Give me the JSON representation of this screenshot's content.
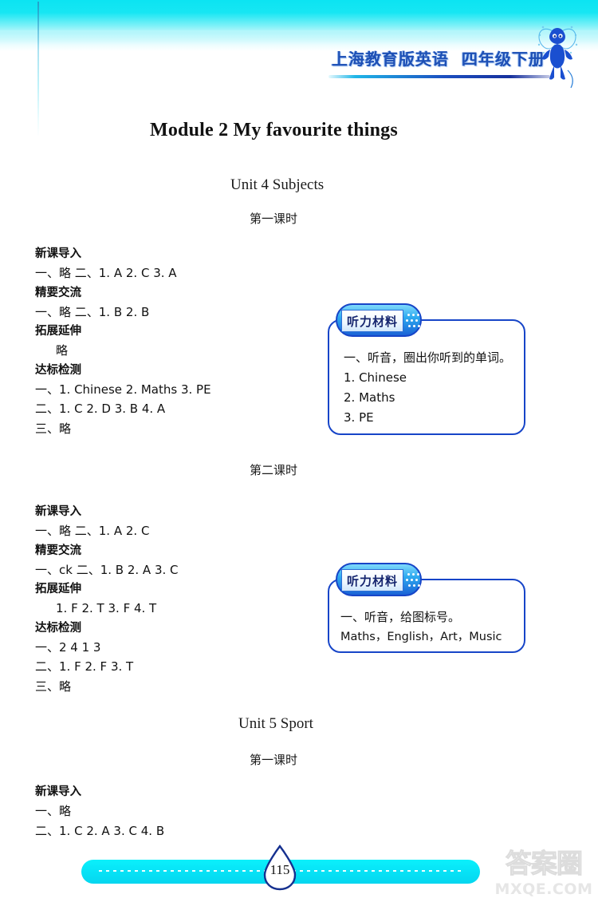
{
  "header": {
    "book_title": "上海教育版英语",
    "grade": "四年级下册",
    "mascot": "fairy-mascot"
  },
  "module": {
    "title": "Module 2 My favourite things"
  },
  "units": [
    {
      "title": "Unit 4 Subjects",
      "lessons": [
        {
          "label": "第一课时"
        },
        {
          "label": "第二课时"
        }
      ]
    },
    {
      "title": "Unit 5 Sport",
      "lessons": [
        {
          "label": "第一课时"
        }
      ]
    }
  ],
  "answers": {
    "u4_l1": [
      {
        "type": "head",
        "text": "新课导入"
      },
      {
        "type": "line",
        "text": "一、略   二、1. A  2. C  3. A"
      },
      {
        "type": "head",
        "text": "精要交流"
      },
      {
        "type": "line",
        "text": "一、略   二、1. B  2. B"
      },
      {
        "type": "head",
        "text": "拓展延伸"
      },
      {
        "type": "indent",
        "text": "略"
      },
      {
        "type": "head",
        "text": "达标检测"
      },
      {
        "type": "line",
        "text": "一、1. Chinese  2. Maths  3. PE"
      },
      {
        "type": "line",
        "text": "二、1. C  2. D  3. B  4. A"
      },
      {
        "type": "line",
        "text": "三、略"
      }
    ],
    "u4_l2": [
      {
        "type": "head",
        "text": "新课导入"
      },
      {
        "type": "line",
        "text": "一、略   二、1. A  2. C"
      },
      {
        "type": "head",
        "text": "精要交流"
      },
      {
        "type": "line",
        "text": "一、ck  二、1. B  2. A  3. C"
      },
      {
        "type": "head",
        "text": "拓展延伸"
      },
      {
        "type": "indent",
        "text": "1. F  2. T  3. F  4. T"
      },
      {
        "type": "head",
        "text": "达标检测"
      },
      {
        "type": "line",
        "text": "一、2 4 1 3"
      },
      {
        "type": "line",
        "text": "二、1. F  2. F  3. T"
      },
      {
        "type": "line",
        "text": "三、略"
      }
    ],
    "u5_l1": [
      {
        "type": "head",
        "text": "新课导入"
      },
      {
        "type": "line",
        "text": "一、略"
      },
      {
        "type": "line",
        "text": "二、1. C  2. A  3. C  4. B"
      }
    ]
  },
  "listening_boxes": [
    {
      "badge": "听力材料",
      "lines": [
        "一、听音，圈出你听到的单词。",
        "    1. Chinese",
        "    2. Maths",
        "    3. PE"
      ]
    },
    {
      "badge": "听力材料",
      "lines": [
        "一、听音，给图标号。",
        "    Maths，English，Art，Music"
      ]
    }
  ],
  "footer": {
    "page_number": "115",
    "watermark_cn": "答案圈",
    "watermark_en": "MXQE.COM"
  },
  "colors": {
    "band_cyan": "#0ce4f2",
    "footer_cyan": "#07e4f7",
    "header_blue": "#1d4fb5",
    "box_border": "#1745c8"
  }
}
